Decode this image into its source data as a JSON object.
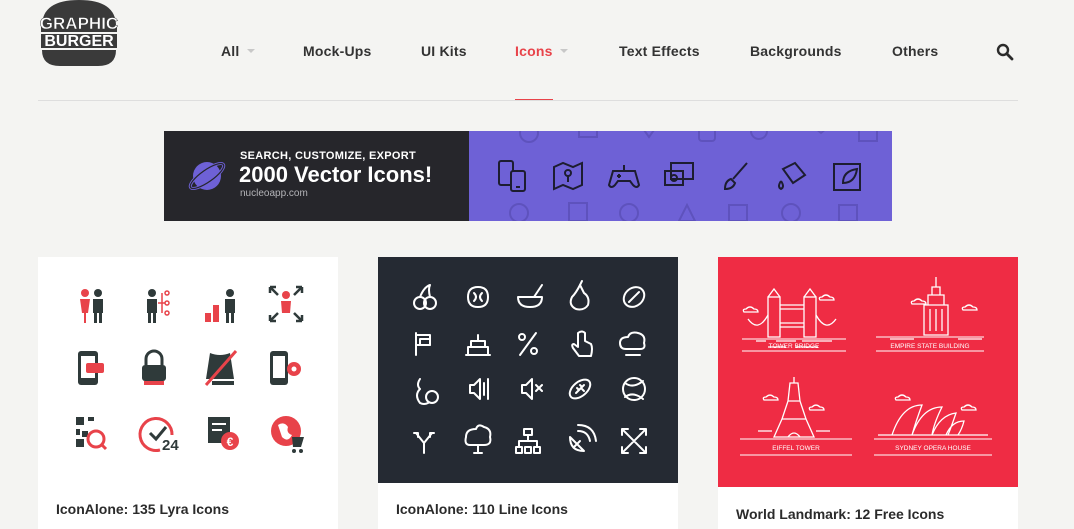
{
  "header": {
    "logo_text_1": "GRAPHIC",
    "logo_text_2": "BURGER",
    "nav": [
      {
        "label": "All",
        "has_caret": true
      },
      {
        "label": "Mock-Ups"
      },
      {
        "label": "UI Kits"
      },
      {
        "label": "Icons",
        "has_caret": true,
        "active": true
      },
      {
        "label": "Text Effects"
      },
      {
        "label": "Backgrounds"
      },
      {
        "label": "Others"
      }
    ],
    "search_icon": "search-icon"
  },
  "banner": {
    "subhead": "SEARCH, CUSTOMIZE, EXPORT",
    "headline": "2000 Vector Icons!",
    "url": "nucleoapp.com",
    "colors": {
      "dark": "#26262b",
      "purple": "#6e61d6"
    }
  },
  "cards": [
    {
      "title": "IconAlone: 135 Lyra Icons",
      "theme": "white"
    },
    {
      "title": "IconAlone: 110 Line Icons",
      "theme": "dark"
    },
    {
      "title": "World Landmark: 12 Free Icons",
      "theme": "red",
      "landmarks": [
        "TOWER BRIDGE",
        "EMPIRE STATE BUILDING",
        "EIFFEL TOWER",
        "SYDNEY OPERA HOUSE"
      ]
    }
  ],
  "card2_thumb_number": "24",
  "colors": {
    "accent": "#e8434a",
    "dark": "#252a33",
    "red": "#ef2c44"
  }
}
